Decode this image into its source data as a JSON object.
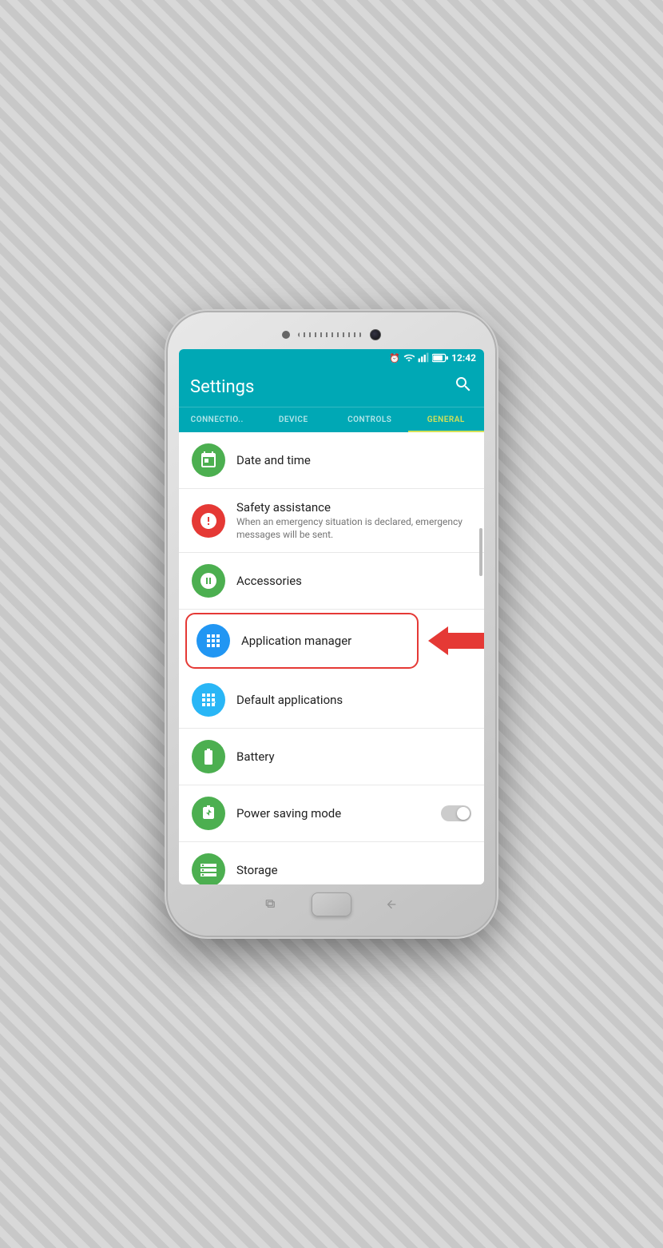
{
  "phone": {
    "status_bar": {
      "time": "12:42",
      "icons": [
        "alarm",
        "wifi",
        "signal",
        "battery"
      ]
    },
    "app_bar": {
      "title": "Settings",
      "search_label": "🔍"
    },
    "tabs": [
      {
        "id": "connections",
        "label": "CONNECTIO..",
        "active": false
      },
      {
        "id": "device",
        "label": "DEVICE",
        "active": false
      },
      {
        "id": "controls",
        "label": "CONTROLS",
        "active": false
      },
      {
        "id": "general",
        "label": "GENERAL",
        "active": true
      }
    ],
    "settings_items": [
      {
        "id": "date-time",
        "icon": "calendar-clock",
        "icon_color": "green",
        "title": "Date and time",
        "subtitle": "",
        "has_toggle": false,
        "highlighted": false
      },
      {
        "id": "safety-assistance",
        "icon": "alert",
        "icon_color": "red",
        "title": "Safety assistance",
        "subtitle": "When an emergency situation is declared, emergency messages will be sent.",
        "has_toggle": false,
        "highlighted": false
      },
      {
        "id": "accessories",
        "icon": "accessories",
        "icon_color": "green",
        "title": "Accessories",
        "subtitle": "",
        "has_toggle": false,
        "highlighted": false
      },
      {
        "id": "application-manager",
        "icon": "apps",
        "icon_color": "blue",
        "title": "Application manager",
        "subtitle": "",
        "has_toggle": false,
        "highlighted": true
      },
      {
        "id": "default-applications",
        "icon": "default-apps",
        "icon_color": "light-blue",
        "title": "Default applications",
        "subtitle": "",
        "has_toggle": false,
        "highlighted": false
      },
      {
        "id": "battery",
        "icon": "battery",
        "icon_color": "green",
        "title": "Battery",
        "subtitle": "",
        "has_toggle": false,
        "highlighted": false
      },
      {
        "id": "power-saving",
        "icon": "power-saving",
        "icon_color": "green",
        "title": "Power saving mode",
        "subtitle": "",
        "has_toggle": true,
        "toggle_on": false,
        "highlighted": false
      },
      {
        "id": "storage",
        "icon": "storage",
        "icon_color": "green",
        "title": "Storage",
        "subtitle": "",
        "has_toggle": false,
        "highlighted": false
      }
    ]
  }
}
